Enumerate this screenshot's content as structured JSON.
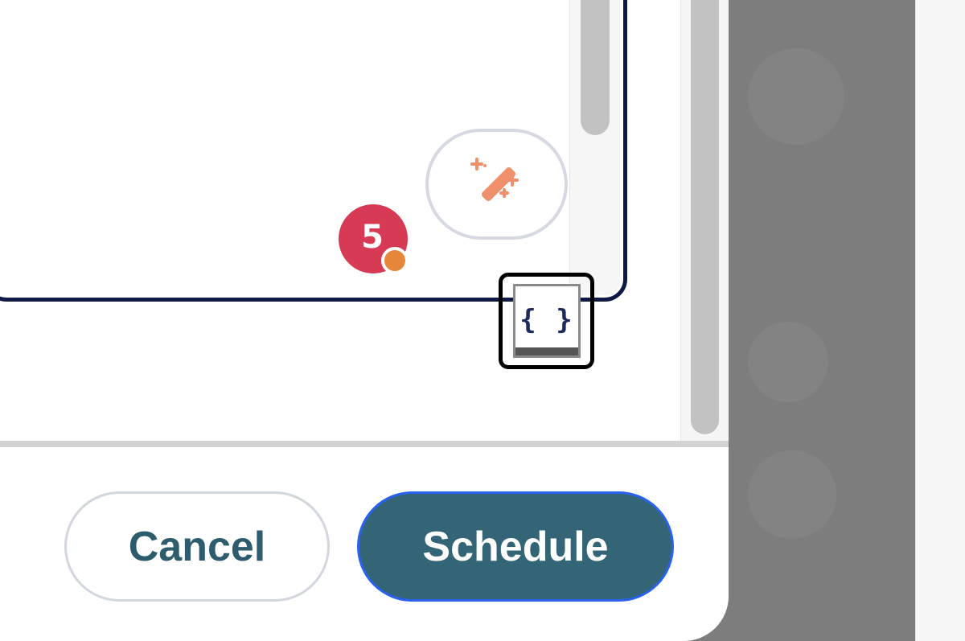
{
  "editor": {
    "mention_count": "5",
    "code_toggle_label": "{ }"
  },
  "footer": {
    "cancel_label": "Cancel",
    "schedule_label": "Schedule"
  },
  "colors": {
    "editor_border": "#0f1946",
    "primary_button": "#336577",
    "primary_button_outline": "#2a62f0",
    "badge": "#d73a54",
    "presence": "#e5863a",
    "magic_icon": "#f0906a"
  },
  "icons": {
    "magic": "magic-wand-icon",
    "code": "code-braces-icon"
  }
}
